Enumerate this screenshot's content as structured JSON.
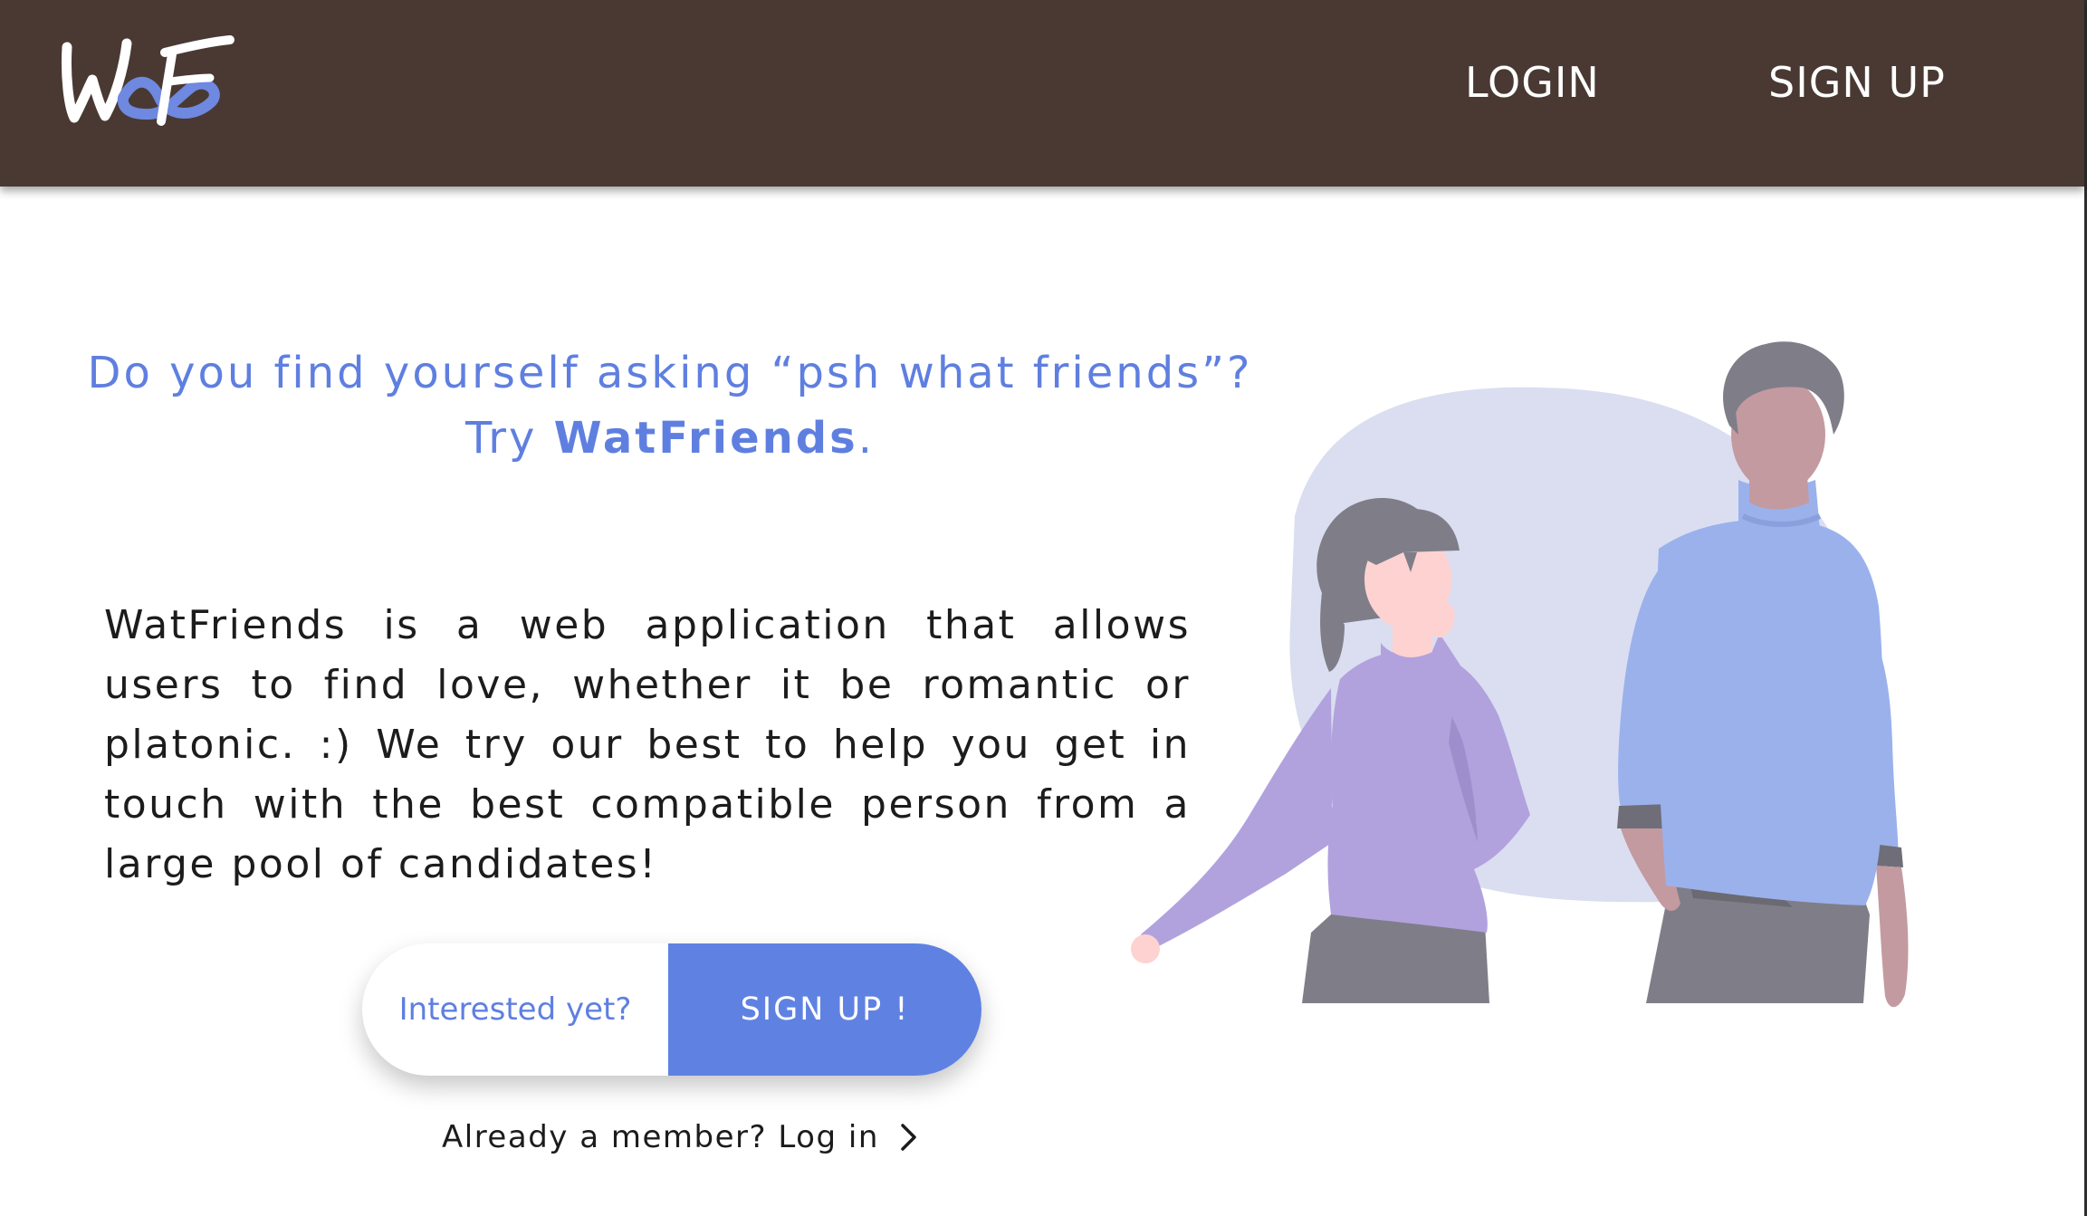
{
  "header": {
    "logo_text": "WF",
    "nav": {
      "login_label": "LOGIN",
      "signup_label": "SIGN UP"
    }
  },
  "hero": {
    "heading_line1": "Do you find yourself asking “psh what friends”?",
    "heading_try": "Try ",
    "heading_brand": "WatFriends",
    "heading_period": "."
  },
  "description": "WatFriends is a web application that allows users to find love, whether it be romantic or platonic. :) We try our best to help you get in touch with the best compatible person from a large pool of candidates!",
  "cta": {
    "prompt": "Interested yet?",
    "signup_label": "SIGN UP !"
  },
  "login_link": {
    "label": "Already a member? Log in"
  },
  "colors": {
    "header_bg": "#493932",
    "accent": "#5f82e2",
    "heading_text": "#5f7fe0"
  }
}
